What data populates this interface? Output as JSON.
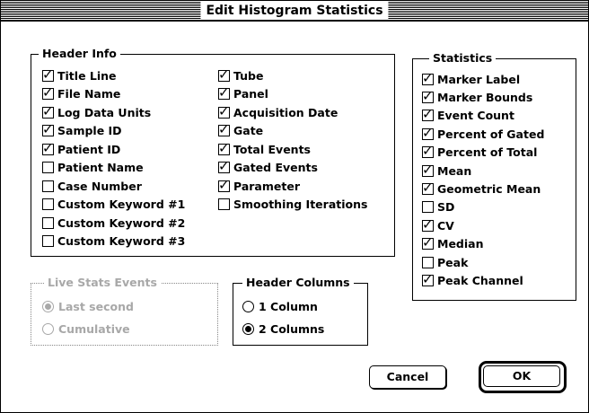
{
  "dialog": {
    "title": "Edit Histogram Statistics"
  },
  "header_info": {
    "label": "Header Info",
    "col1": [
      {
        "label": "Title Line",
        "checked": true
      },
      {
        "label": "File Name",
        "checked": true
      },
      {
        "label": "Log Data Units",
        "checked": true
      },
      {
        "label": "Sample ID",
        "checked": true
      },
      {
        "label": "Patient ID",
        "checked": true
      },
      {
        "label": "Patient Name",
        "checked": false
      },
      {
        "label": "Case Number",
        "checked": false
      },
      {
        "label": "Custom Keyword #1",
        "checked": false
      },
      {
        "label": "Custom Keyword #2",
        "checked": false
      },
      {
        "label": "Custom Keyword #3",
        "checked": false
      }
    ],
    "col2": [
      {
        "label": "Tube",
        "checked": true
      },
      {
        "label": "Panel",
        "checked": true
      },
      {
        "label": "Acquisition Date",
        "checked": true
      },
      {
        "label": "Gate",
        "checked": true
      },
      {
        "label": "Total Events",
        "checked": true
      },
      {
        "label": "Gated Events",
        "checked": true
      },
      {
        "label": "Parameter",
        "checked": true
      },
      {
        "label": "Smoothing Iterations",
        "checked": false
      }
    ]
  },
  "statistics": {
    "label": "Statistics",
    "items": [
      {
        "label": "Marker Label",
        "checked": true
      },
      {
        "label": "Marker Bounds",
        "checked": true
      },
      {
        "label": "Event Count",
        "checked": true
      },
      {
        "label": "Percent of Gated",
        "checked": true
      },
      {
        "label": "Percent of Total",
        "checked": true
      },
      {
        "label": "Mean",
        "checked": true
      },
      {
        "label": "Geometric Mean",
        "checked": true
      },
      {
        "label": "SD",
        "checked": false
      },
      {
        "label": "CV",
        "checked": true
      },
      {
        "label": "Median",
        "checked": true
      },
      {
        "label": "Peak",
        "checked": false
      },
      {
        "label": "Peak Channel",
        "checked": true
      }
    ]
  },
  "live_stats": {
    "label": "Live Stats Events",
    "disabled": true,
    "options": [
      {
        "label": "Last second",
        "selected": true
      },
      {
        "label": "Cumulative",
        "selected": false
      }
    ]
  },
  "header_columns": {
    "label": "Header Columns",
    "options": [
      {
        "label": "1 Column",
        "selected": false
      },
      {
        "label": "2 Columns",
        "selected": true
      }
    ]
  },
  "buttons": {
    "cancel": "Cancel",
    "ok": "OK"
  }
}
